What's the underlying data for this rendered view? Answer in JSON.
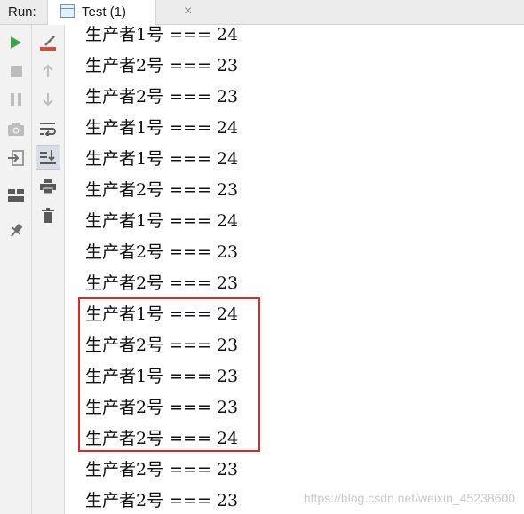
{
  "titlebar": {
    "run_label": "Run:",
    "tab_label": "Test (1)",
    "tab_close": "×"
  },
  "toolbar_left": [
    "run-icon",
    "stop-icon",
    "pause-icon",
    "camera-icon",
    "login-icon",
    "layout-icon",
    "pin-icon"
  ],
  "toolbar_right": [
    "clear-icon",
    "up-arrow-icon",
    "down-arrow-icon",
    "soft-wrap-icon",
    "scroll-to-end-icon",
    "print-icon",
    "trash-icon"
  ],
  "console": {
    "lines": [
      "生产者1号 === 24",
      "生产者2号 === 23",
      "生产者2号 === 23",
      "生产者1号 === 24",
      "生产者1号 === 24",
      "生产者2号 === 23",
      "生产者1号 === 24",
      "生产者2号 === 23",
      "生产者2号 === 23",
      "生产者1号 === 24",
      "生产者2号 === 23",
      "生产者1号 === 23",
      "生产者2号 === 23",
      "生产者2号 === 24",
      "生产者2号 === 23",
      "生产者2号 === 23"
    ]
  },
  "watermark": "https://blog.csdn.net/weixin_45238600",
  "colors": {
    "run_green": "#3ea14b",
    "highlight_red": "#d92b2b",
    "clear_red": "#d84a3a"
  }
}
